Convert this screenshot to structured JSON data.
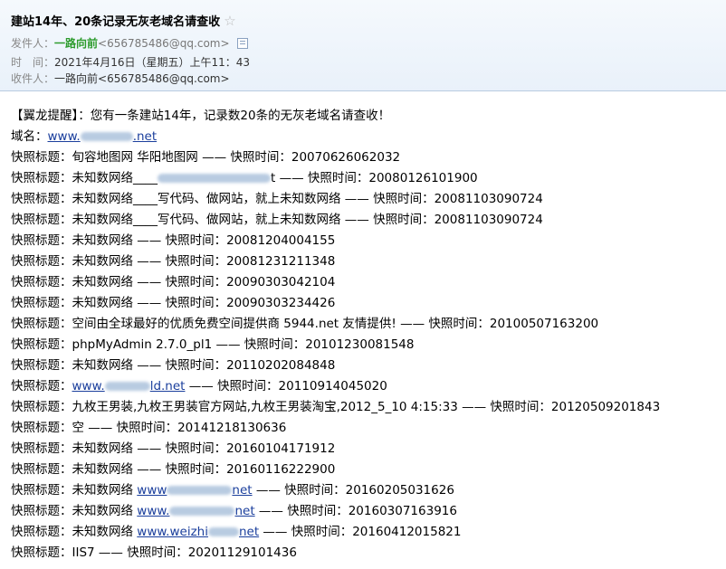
{
  "email": {
    "subject": "建站14年、20条记录无灰老域名请查收",
    "from_label": "发件人：",
    "from_name": "一路向前",
    "from_addr": "<656785486@qq.com>",
    "time_label": "时　间：",
    "time_value": "2021年4月16日（星期五）上午11：43",
    "to_label": "收件人：",
    "to_name": "一路向前",
    "to_addr": "<656785486@qq.com>"
  },
  "body": {
    "intro": "【翼龙提醒】：您有一条建站14年，记录数20条的无灰老域名请查收！",
    "domain_label": "域名：",
    "domain_prefix": "www.",
    "domain_suffix": ".net",
    "lines": [
      "快照标题：旬容地图网 华阳地图网 —— 快照时间：20070626062032",
      "快照标题：未知数网络____",
      "t —— 快照时间：20080126101900",
      "快照标题：未知数网络____写代码、做网站，就上未知数网络 —— 快照时间：20081103090724",
      "快照标题：未知数网络____写代码、做网站，就上未知数网络 —— 快照时间：20081103090724",
      "快照标题：未知数网络 —— 快照时间：20081204004155",
      "快照标题：未知数网络 —— 快照时间：20081231211348",
      "快照标题：未知数网络 —— 快照时间：20090303042104",
      "快照标题：未知数网络 —— 快照时间：20090303234426",
      "快照标题：空间由全球最好的优质免费空间提供商 5944.net 友情提供! —— 快照时间：20100507163200",
      "快照标题：phpMyAdmin 2.7.0_pl1 —— 快照时间：20101230081548",
      "快照标题：未知数网络 —— 快照时间：20110202084848",
      "快照标题：",
      "www.",
      "ld.net",
      " —— 快照时间：20110914045020",
      "快照标题：九枚王男装,九枚王男装官方网站,九枚王男装淘宝,2012_5_10 4:15:33 —— 快照时间：20120509201843",
      "快照标题：空 —— 快照时间：20141218130636",
      "快照标题：未知数网络 —— 快照时间：20160104171912",
      "快照标题：未知数网络 —— 快照时间：20160116222900",
      "快照标题：未知数网络 ",
      "www",
      "net",
      " —— 快照时间：20160205031626",
      "快照标题：未知数网络 ",
      "www.",
      "net",
      " —— 快照时间：20160307163916",
      "快照标题：未知数网络 ",
      "www.weizhi",
      "net",
      " —— 快照时间：20160412015821",
      "快照标题：IIS7 —— 快照时间：20201129101436"
    ]
  }
}
